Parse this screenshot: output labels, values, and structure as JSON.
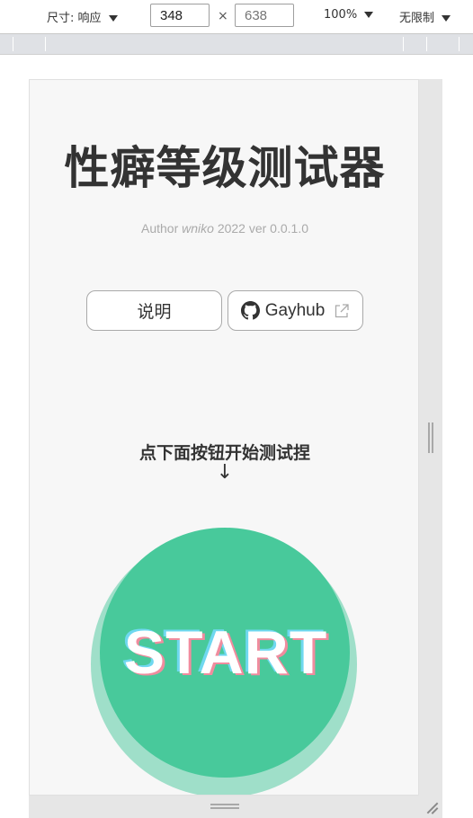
{
  "toolbar": {
    "size_label": "尺寸: 响应",
    "width": "348",
    "height": "638",
    "times": "×",
    "zoom": "100%",
    "throttle": "无限制"
  },
  "page": {
    "title": "性癖等级测试器",
    "author_prefix": "Author",
    "author_name": "wniko",
    "author_suffix": "2022 ver 0.0.1.0",
    "help_button": "说明",
    "github_button": "Gayhub",
    "hint": "点下面按钮开始测试捏",
    "arrow": "↓",
    "start_button": "START"
  },
  "colors": {
    "accent": "#48c99b",
    "start_shadow_pink": "#f08c9e",
    "start_shadow_cyan": "#6fd8f0"
  },
  "icons": [
    "caret-down-icon",
    "github-icon",
    "external-link-icon",
    "resize-handle-icon"
  ]
}
